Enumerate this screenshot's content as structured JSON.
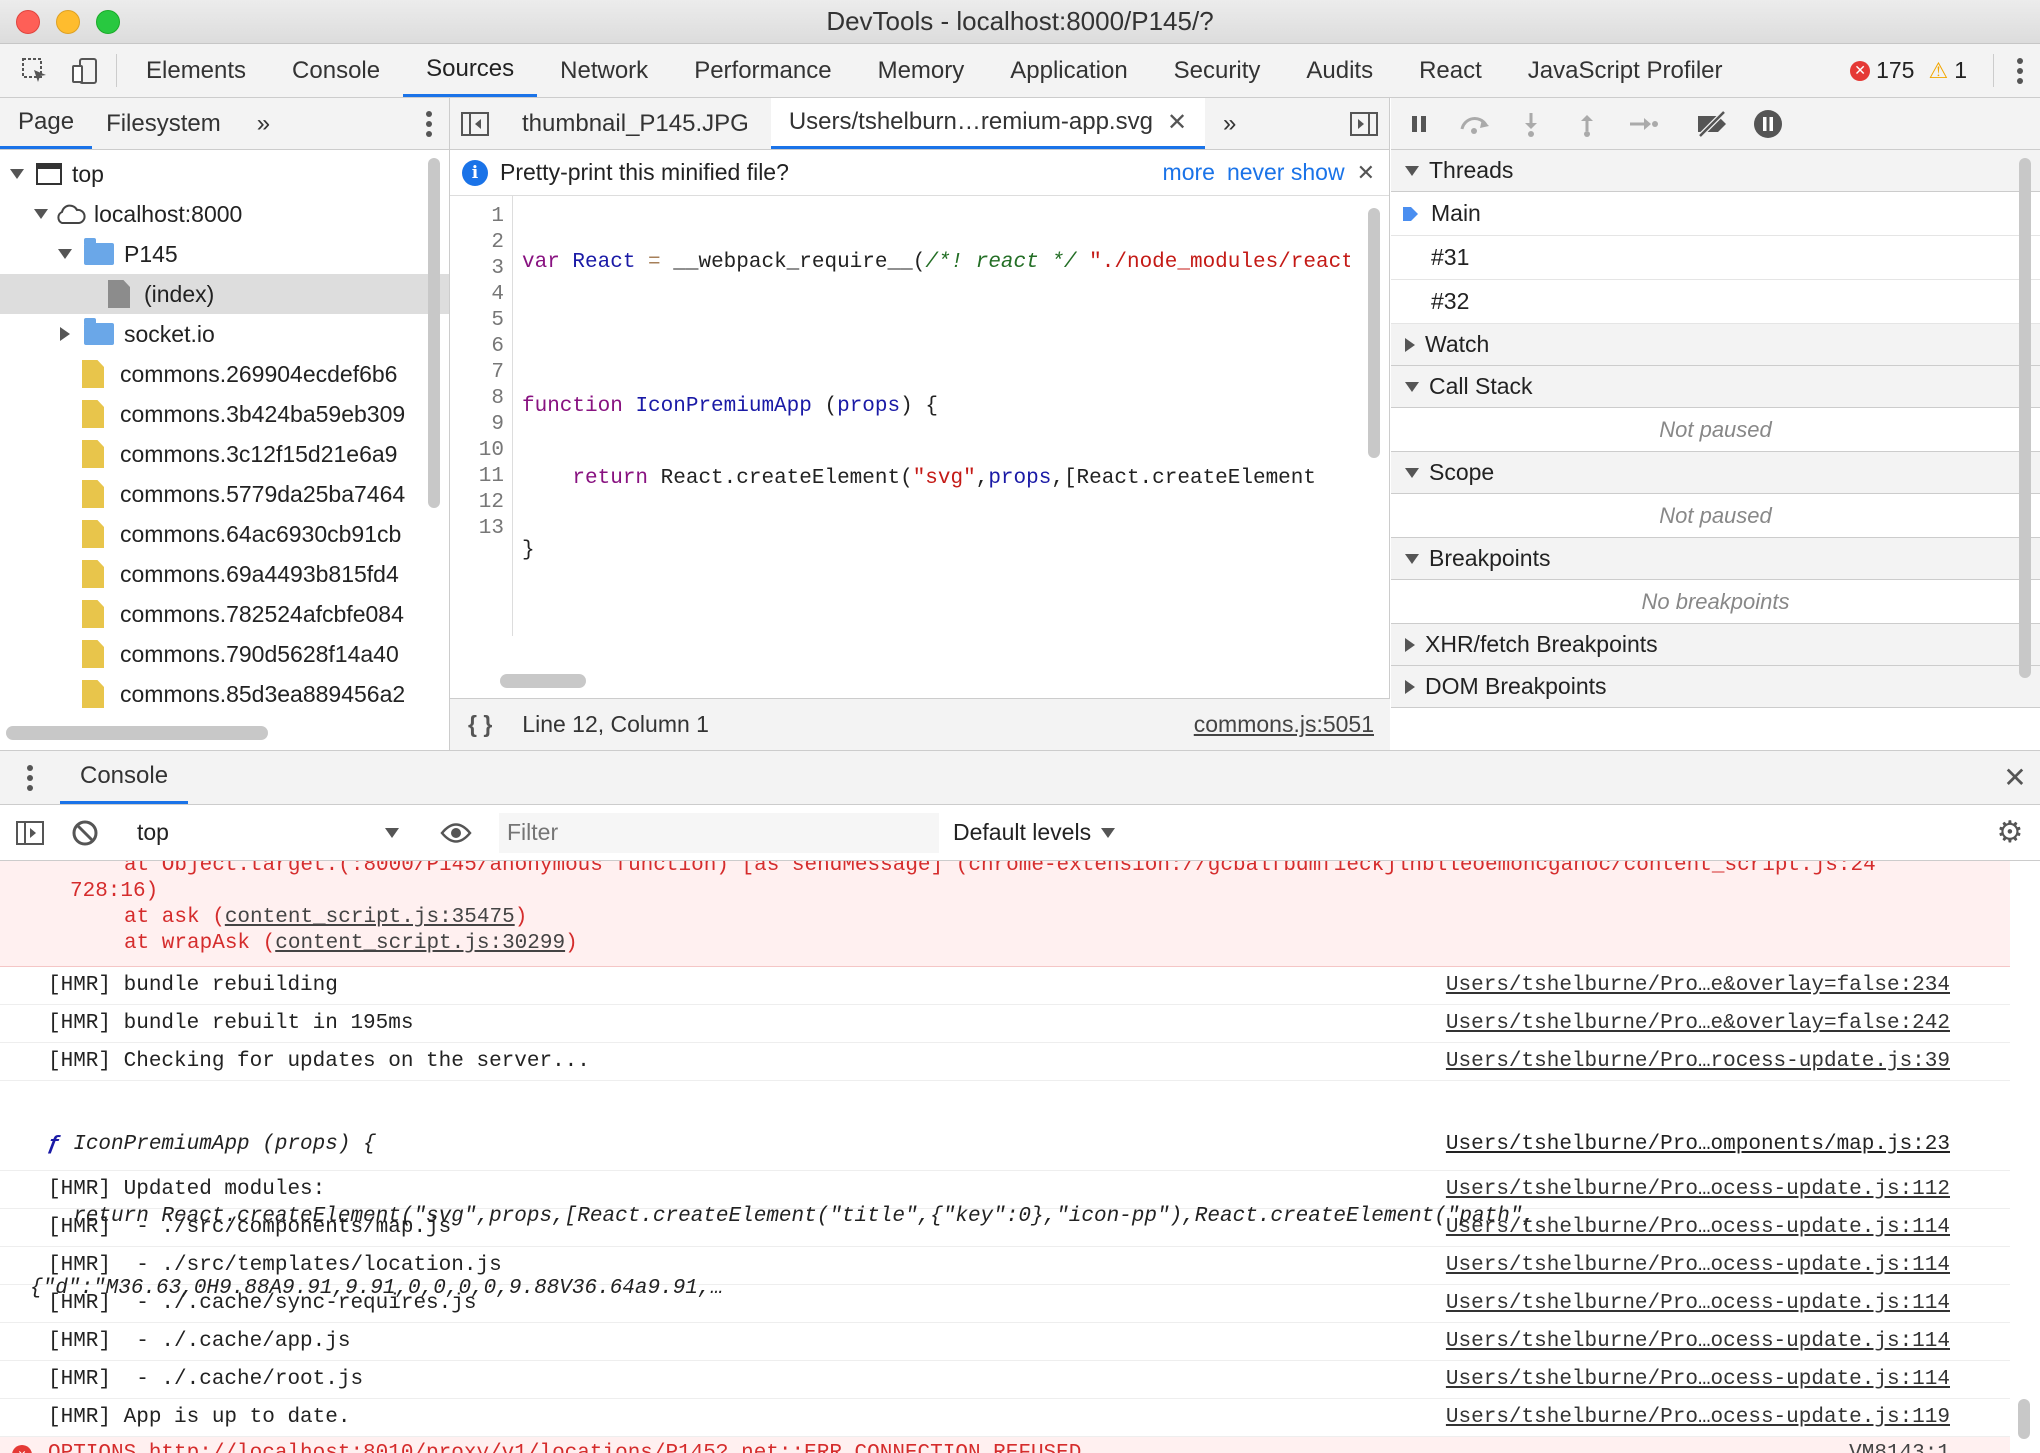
{
  "window": {
    "title": "DevTools - localhost:8000/P145/?"
  },
  "main_tabs": [
    "Elements",
    "Console",
    "Sources",
    "Network",
    "Performance",
    "Memory",
    "Application",
    "Security",
    "Audits",
    "React",
    "JavaScript Profiler"
  ],
  "active_main_tab": "Sources",
  "counts": {
    "errors": "175",
    "warnings": "1"
  },
  "navigator": {
    "tabs": [
      "Page",
      "Filesystem"
    ],
    "more": "»",
    "tree": {
      "top": "top",
      "host": "localhost:8000",
      "folder1": "P145",
      "index": "(index)",
      "folder2": "socket.io",
      "files": [
        "commons.269904ecdef6b6",
        "commons.3b424ba59eb309",
        "commons.3c12f15d21e6a9",
        "commons.5779da25ba7464",
        "commons.64ac6930cb91cb",
        "commons.69a4493b815fd4",
        "commons.782524afcbfe084",
        "commons.790d5628f14a40",
        "commons.85d3ea889456a2"
      ]
    }
  },
  "editor": {
    "tabs": [
      "thumbnail_P145.JPG",
      "Users/tshelburn…remium-app.svg"
    ],
    "more": "»",
    "infobar": {
      "text": "Pretty-print this minified file?",
      "more": "more",
      "never": "never show"
    },
    "line_numbers": [
      "1",
      "2",
      "3",
      "4",
      "5",
      "6",
      "7",
      "8",
      "9",
      "10",
      "11",
      "12",
      "13"
    ],
    "status": {
      "position": "Line 12, Column 1",
      "source": "commons.js:5051",
      "format": "{ }"
    }
  },
  "debugger": {
    "threads_label": "Threads",
    "threads": [
      "Main",
      "#31",
      "#32"
    ],
    "watch": "Watch",
    "call_stack": "Call Stack",
    "not_paused": "Not paused",
    "scope": "Scope",
    "scope_empty": "Not paused",
    "breakpoints": "Breakpoints",
    "no_breakpoints": "No breakpoints",
    "xhr": "XHR/fetch Breakpoints",
    "dom": "DOM Breakpoints"
  },
  "console": {
    "tab": "Console",
    "context": "top",
    "filter_placeholder": "Filter",
    "levels": "Default levels",
    "error_lines": {
      "l1": "at Object.target.(:8000/P145/anonymous function) [as sendMessage] (chrome-extension://gcbalfbdmfieckjlnblleoemohcganoc/content_script.js:24",
      "l2": "728:16)",
      "l3a": "at ask (",
      "l3b": "content_script.js:35475",
      "l3c": ")",
      "l4a": "at wrapAsk (",
      "l4b": "content_script.js:30299",
      "l4c": ")"
    },
    "messages": [
      {
        "text": "[HMR] bundle rebuilding",
        "src": "Users/tshelburne/Pro…e&overlay=false:234"
      },
      {
        "text": "[HMR] bundle rebuilt in 195ms",
        "src": "Users/tshelburne/Pro…e&overlay=false:242"
      },
      {
        "text": "[HMR] Checking for updates on the server...",
        "src": "Users/tshelburne/Pro…rocess-update.js:39"
      }
    ],
    "fn_msg": {
      "l1": "IconPremiumApp (props) {",
      "l2": "  return React.createElement(\"svg\",props,[React.createElement(\"title\",{\"key\":0},\"icon-pp\"),React.createElement(\"path\",",
      "l3": "{\"d\":\"M36.63,0H9.88A9.91,9.91,0,0,0,0,9.88V36.64a9.91,…",
      "src": "Users/tshelburne/Pro…omponents/map.js:23"
    },
    "messages2": [
      {
        "text": "[HMR] Updated modules:",
        "src": "Users/tshelburne/Pro…ocess-update.js:112"
      },
      {
        "text": "[HMR]  - ./src/components/map.js",
        "src": "Users/tshelburne/Pro…ocess-update.js:114"
      },
      {
        "text": "[HMR]  - ./src/templates/location.js",
        "src": "Users/tshelburne/Pro…ocess-update.js:114"
      },
      {
        "text": "[HMR]  - ./.cache/sync-requires.js",
        "src": "Users/tshelburne/Pro…ocess-update.js:114"
      },
      {
        "text": "[HMR]  - ./.cache/app.js",
        "src": "Users/tshelburne/Pro…ocess-update.js:114"
      },
      {
        "text": "[HMR]  - ./.cache/root.js",
        "src": "Users/tshelburne/Pro…ocess-update.js:114"
      },
      {
        "text": "[HMR] App is up to date.",
        "src": "Users/tshelburne/Pro…ocess-update.js:119"
      }
    ],
    "last_error": {
      "text": "OPTIONS http://localhost:8010/proxy/v1/locations/P145? net::ERR_CONNECTION_REFUSED",
      "src": "VM8143:1"
    }
  }
}
